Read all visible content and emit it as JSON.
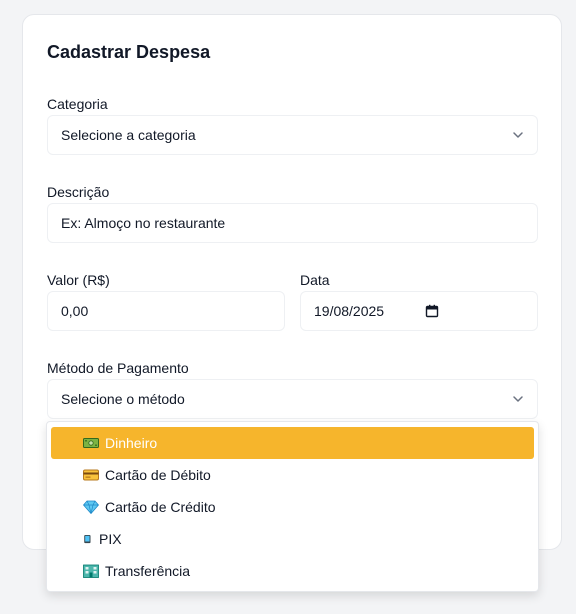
{
  "form": {
    "title": "Cadastrar Despesa",
    "category": {
      "label": "Categoria",
      "value": "Selecione a categoria"
    },
    "description": {
      "label": "Descrição",
      "placeholder": "Ex: Almoço no restaurante"
    },
    "amount": {
      "label": "Valor (R$)",
      "value": "0,00"
    },
    "date": {
      "label": "Data",
      "value": "19/08/2025"
    },
    "payment": {
      "label": "Método de Pagamento",
      "value": "Selecione o método"
    }
  },
  "payment_options": [
    {
      "label": "Dinheiro",
      "icon": "banknote-icon",
      "selected": true
    },
    {
      "label": "Cartão de Débito",
      "icon": "credit-card-icon",
      "selected": false
    },
    {
      "label": "Cartão de Crédito",
      "icon": "gem-icon",
      "selected": false
    },
    {
      "label": "PIX",
      "icon": "mobile-phone-icon",
      "selected": false
    },
    {
      "label": "Transferência",
      "icon": "bank-building-icon",
      "selected": false
    }
  ],
  "colors": {
    "selected_option_bg": "#f6b52c",
    "text": "#111827",
    "border": "#e5e7eb"
  }
}
